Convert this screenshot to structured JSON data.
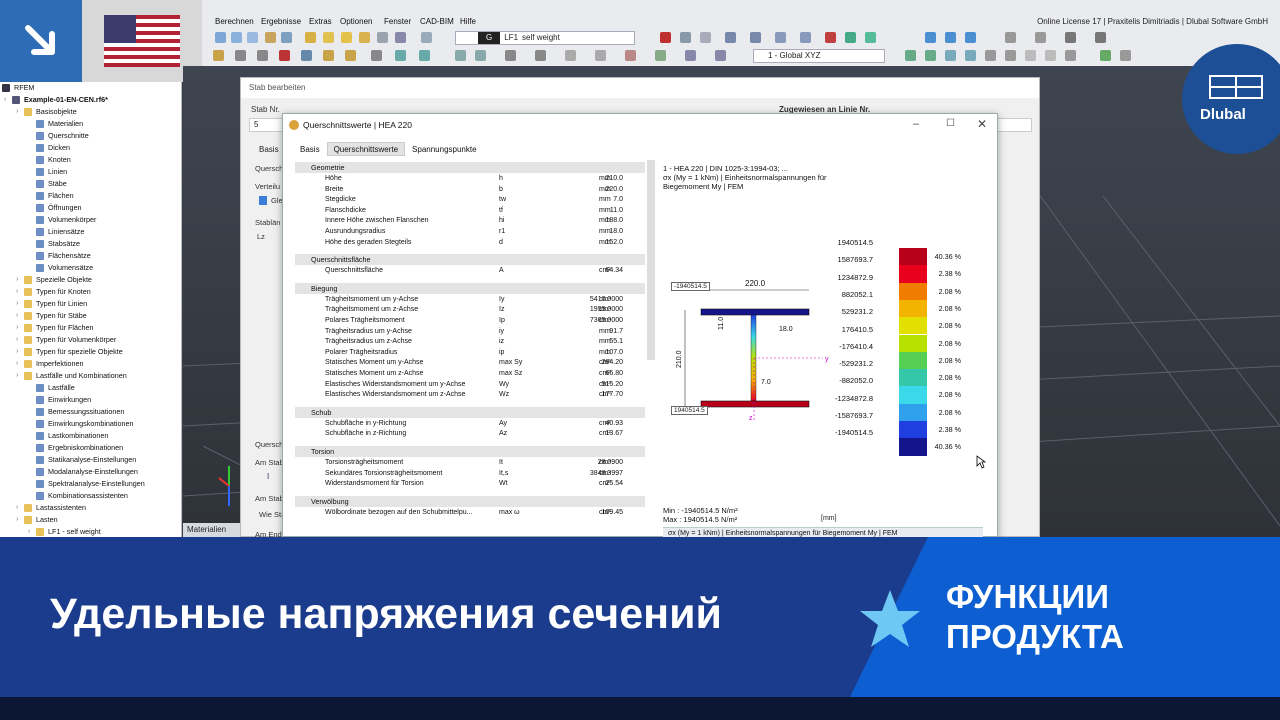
{
  "menu": [
    "Berechnen",
    "Ergebnisse",
    "Extras",
    "Optionen",
    "Fenster",
    "CAD-BIM",
    "Hilfe"
  ],
  "license": "Online License 17 | Praxitelis Dimitriadis | Dlubal Software GmbH",
  "toolbar": {
    "lc_tag": "G",
    "lc_id": "LF1",
    "lc_name": "self weight",
    "coord_system": "1 - Global XYZ"
  },
  "tree": {
    "header": "RFEM",
    "items": [
      {
        "label": "Example-01-EN-CEN.rf6*",
        "depth": 0,
        "icon": "file-icon"
      },
      {
        "label": "Basisobjekte",
        "depth": 1,
        "icon": "folder-icon"
      },
      {
        "label": "Materialien",
        "depth": 2,
        "icon": "material-icon"
      },
      {
        "label": "Querschnitte",
        "depth": 2,
        "icon": "section-icon"
      },
      {
        "label": "Dicken",
        "depth": 2,
        "icon": "thickness-icon"
      },
      {
        "label": "Knoten",
        "depth": 2,
        "icon": "node-icon"
      },
      {
        "label": "Linien",
        "depth": 2,
        "icon": "line-icon"
      },
      {
        "label": "Stäbe",
        "depth": 2,
        "icon": "member-icon"
      },
      {
        "label": "Flächen",
        "depth": 2,
        "icon": "surface-icon"
      },
      {
        "label": "Öffnungen",
        "depth": 2,
        "icon": "opening-icon"
      },
      {
        "label": "Volumenkörper",
        "depth": 2,
        "icon": "solid-icon"
      },
      {
        "label": "Liniensätze",
        "depth": 2,
        "icon": "lineset-icon"
      },
      {
        "label": "Stabsätze",
        "depth": 2,
        "icon": "memberset-icon"
      },
      {
        "label": "Flächensätze",
        "depth": 2,
        "icon": "surfaceset-icon"
      },
      {
        "label": "Volumensätze",
        "depth": 2,
        "icon": "solidset-icon"
      },
      {
        "label": "Spezielle Objekte",
        "depth": 1,
        "icon": "folder-icon"
      },
      {
        "label": "Typen für Knoten",
        "depth": 1,
        "icon": "folder-icon"
      },
      {
        "label": "Typen für Linien",
        "depth": 1,
        "icon": "folder-icon"
      },
      {
        "label": "Typen für Stäbe",
        "depth": 1,
        "icon": "folder-icon"
      },
      {
        "label": "Typen für Flächen",
        "depth": 1,
        "icon": "folder-icon"
      },
      {
        "label": "Typen für Volumenkörper",
        "depth": 1,
        "icon": "folder-icon"
      },
      {
        "label": "Typen für spezielle Objekte",
        "depth": 1,
        "icon": "folder-icon"
      },
      {
        "label": "Imperfektionen",
        "depth": 1,
        "icon": "folder-icon"
      },
      {
        "label": "Lastfälle und Kombinationen",
        "depth": 1,
        "icon": "folder-icon"
      },
      {
        "label": "Lastfälle",
        "depth": 2,
        "icon": "loadcase-icon"
      },
      {
        "label": "Einwirkungen",
        "depth": 2,
        "icon": "action-icon"
      },
      {
        "label": "Bemessungssituationen",
        "depth": 2,
        "icon": "design-situation-icon"
      },
      {
        "label": "Einwirkungskombinationen",
        "depth": 2,
        "icon": "action-combination-icon"
      },
      {
        "label": "Lastkombinationen",
        "depth": 2,
        "icon": "load-combination-icon"
      },
      {
        "label": "Ergebniskombinationen",
        "depth": 2,
        "icon": "result-combination-icon"
      },
      {
        "label": "Statikanalyse-Einstellungen",
        "depth": 2,
        "icon": "settings-icon"
      },
      {
        "label": "Modalanalyse-Einstellungen",
        "depth": 2,
        "icon": "settings-icon"
      },
      {
        "label": "Spektralanalyse-Einstellungen",
        "depth": 2,
        "icon": "settings-icon"
      },
      {
        "label": "Kombinationsassistenten",
        "depth": 2,
        "icon": "wizard-icon"
      },
      {
        "label": "Lastassistenten",
        "depth": 1,
        "icon": "folder-icon"
      },
      {
        "label": "Lasten",
        "depth": 1,
        "icon": "folder-icon"
      },
      {
        "label": "LF1 - self weight",
        "depth": 2,
        "icon": "folder-icon"
      }
    ]
  },
  "materials_tab": "Materialien",
  "back_dialog": {
    "title": "Stab bearbeiten",
    "stab_nr_label": "Stab Nr.",
    "stab_nr": "5",
    "assigned_label": "Zugewiesen an Linie Nr.",
    "tab_basis": "Basis",
    "frag": [
      "Querschn",
      "Verteilu",
      "Glei",
      "Stablän",
      "Lz",
      "Querschn",
      "Am Stab",
      "I",
      "Am Stab",
      "Wie Sta",
      "Am Ende"
    ]
  },
  "dialog": {
    "title": "Querschnittswerte | HEA 220",
    "tabs": [
      "Basis",
      "Querschnittswerte",
      "Spannungspunkte"
    ],
    "groups": [
      {
        "name": "Geometrie",
        "rows": [
          [
            "Höhe",
            "h",
            "210.0",
            "mm"
          ],
          [
            "Breite",
            "b",
            "220.0",
            "mm"
          ],
          [
            "Stegdicke",
            "tw",
            "7.0",
            "mm"
          ],
          [
            "Flanschdicke",
            "tf",
            "11.0",
            "mm"
          ],
          [
            "Innere Höhe zwischen Flanschen",
            "hi",
            "188.0",
            "mm"
          ],
          [
            "Ausrundungsradius",
            "r1",
            "18.0",
            "mm"
          ],
          [
            "Höhe des geraden Stegteils",
            "d",
            "152.0",
            "mm"
          ]
        ]
      },
      {
        "name": "Querschnittsfläche",
        "rows": [
          [
            "Querschnittsfläche",
            "A",
            "64.34",
            "cm²"
          ]
        ]
      },
      {
        "name": "Biegung",
        "rows": [
          [
            "Trägheitsmoment um y-Achse",
            "Iy",
            "5410.0000",
            "cm⁴"
          ],
          [
            "Trägheitsmoment um z-Achse",
            "Iz",
            "1955.0000",
            "cm⁴"
          ],
          [
            "Polares Trägheitsmoment",
            "Ip",
            "7365.0000",
            "cm⁴"
          ],
          [
            "Trägheitsradius um y-Achse",
            "iy",
            "91.7",
            "mm"
          ],
          [
            "Trägheitsradius um z-Achse",
            "iz",
            "55.1",
            "mm"
          ],
          [
            "Polarer Trägheitsradius",
            "ip",
            "107.0",
            "mm"
          ],
          [
            "Statisches Moment um y-Achse",
            "max Sy",
            "284.20",
            "cm³"
          ],
          [
            "Statisches Moment um z-Achse",
            "max Sz",
            "66.80",
            "cm³"
          ],
          [
            "Elastisches Widerstandsmoment um y-Achse",
            "Wy",
            "515.20",
            "cm³"
          ],
          [
            "Elastisches Widerstandsmoment um z-Achse",
            "Wz",
            "177.70",
            "cm³"
          ]
        ]
      },
      {
        "name": "Schub",
        "rows": [
          [
            "Schubfläche in y-Richtung",
            "Ay",
            "40.93",
            "cm²"
          ],
          [
            "Schubfläche in z-Richtung",
            "Az",
            "13.67",
            "cm²"
          ]
        ]
      },
      {
        "name": "Torsion",
        "rows": [
          [
            "Torsionsträgheitsmoment",
            "It",
            "28.0900",
            "cm⁴"
          ],
          [
            "Sekundäres Torsionsträgheitsmoment",
            "It,s",
            "3848.3997",
            "cm⁴"
          ],
          [
            "Widerstandsmoment für Torsion",
            "Wt",
            "25.54",
            "cm³"
          ]
        ]
      },
      {
        "name": "Verwölbung",
        "rows": [
          [
            "Wölbordinate bezogen auf den Schubmittelpu...",
            "max ω",
            "109.45",
            "cm²"
          ]
        ]
      }
    ],
    "graphic": {
      "info1": "1 - HEA 220 | DIN 1025-3:1994-03; ...",
      "info2": "σx (My = 1 kNm) | Einheitsnormalspannungen für",
      "info3": "Biegemoment My | FEM",
      "dim_b": "220.0",
      "dim_h": "210.0",
      "dim_tf": "11.0",
      "dim_r": "18.0",
      "dim_tw": "7.0",
      "label_top": "-1940514.5",
      "label_bottom": "1940514.5",
      "axis_y": "y",
      "axis_z": "z",
      "min": "Min : -1940514.5 N/m²",
      "max": "Max :  1940514.5 N/m²",
      "unit": "[mm]",
      "combo": "σx (My = 1 kNm) | Einheitsnormalspannungen für Biegemoment My | FEM",
      "legend_values": [
        "1940514.5",
        "1587693.7",
        "1234872.9",
        "882052.1",
        "529231.2",
        "176410.5",
        "-176410.4",
        "-529231.2",
        "-882052.0",
        "-1234872.8",
        "-1587693.7",
        "-1940514.5"
      ],
      "legend_colors": [
        "#b8001a",
        "#e8001c",
        "#f07d00",
        "#f2b400",
        "#e2e000",
        "#b8e000",
        "#55d055",
        "#35c8a8",
        "#3ad8e8",
        "#2ea0ec",
        "#1f3fe0",
        "#14148c"
      ],
      "legend_pcts": [
        "40.36 %",
        "2.38 %",
        "2.08 %",
        "2.08 %",
        "2.08 %",
        "2.08 %",
        "2.08 %",
        "2.08 %",
        "2.08 %",
        "2.08 %",
        "2.38 %",
        "40.36 %"
      ]
    }
  },
  "brand": "Dlubal",
  "banner": {
    "title": "Удельные напряжения сечений",
    "feature_line1": "ФУНКЦИИ",
    "feature_line2": "ПРОДУКТА"
  }
}
